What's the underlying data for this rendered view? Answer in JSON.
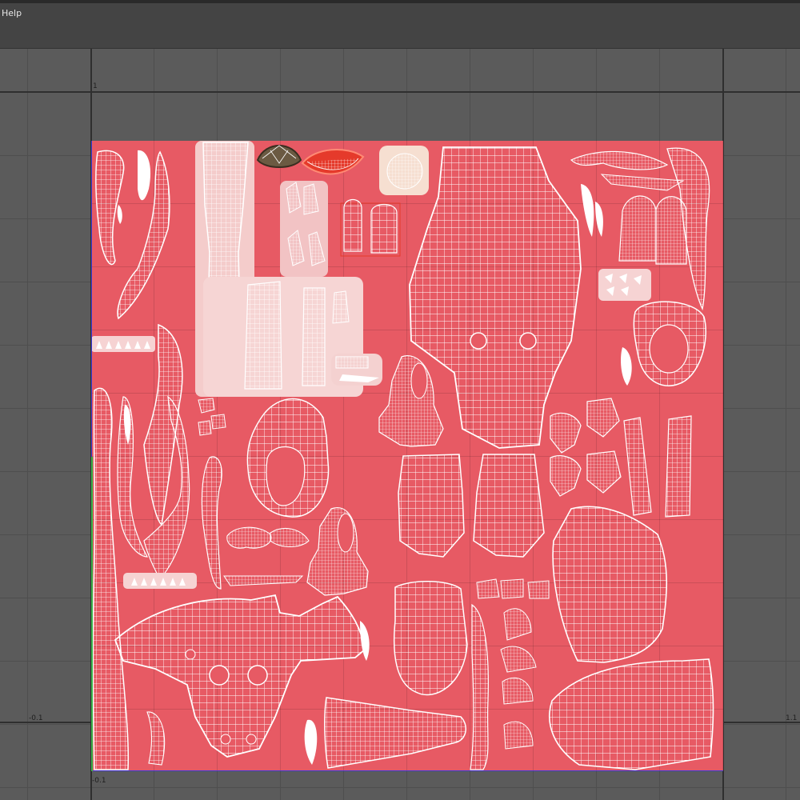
{
  "menu": {
    "help_label": "Help"
  },
  "axis_labels": {
    "u_one": "1",
    "u_minus": "-0.1",
    "u_overflow": "1.1",
    "v_minus": "-0.1"
  },
  "editor": {
    "tile_color": "#e75a64",
    "wire_color": "#ffffff",
    "selected_color": "#e53a2b",
    "background_color": "#5b5b5b"
  },
  "icons": {
    "help": "help-menu"
  }
}
